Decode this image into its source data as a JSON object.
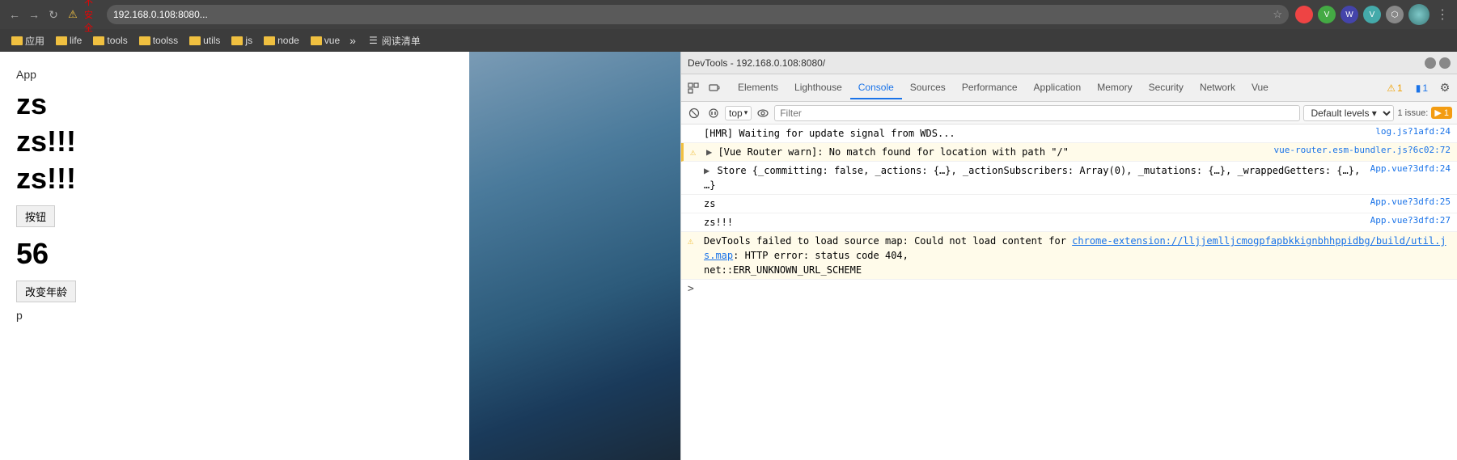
{
  "browser": {
    "url": "192.168.0.108:8080...",
    "security_warning": "不安全",
    "bookmarks": [
      {
        "label": "应用",
        "type": "folder"
      },
      {
        "label": "life",
        "type": "folder"
      },
      {
        "label": "tools",
        "type": "folder"
      },
      {
        "label": "toolss",
        "type": "folder"
      },
      {
        "label": "utils",
        "type": "folder"
      },
      {
        "label": "js",
        "type": "folder"
      },
      {
        "label": "node",
        "type": "folder"
      },
      {
        "label": "vue",
        "type": "folder"
      },
      {
        "label": "阅读清单",
        "type": "link"
      }
    ],
    "more_label": "»"
  },
  "webpage": {
    "app_label": "App",
    "zs": "zs",
    "zs_exclaim1": "zs!!!",
    "zs_exclaim2": "zs!!!",
    "button1": "按钮",
    "number": "56",
    "button2": "改变年龄",
    "p_text": "p"
  },
  "devtools": {
    "title": "DevTools - 192.168.0.108:8080/",
    "tabs": [
      {
        "label": "Elements",
        "active": false
      },
      {
        "label": "Lighthouse",
        "active": false
      },
      {
        "label": "Console",
        "active": true
      },
      {
        "label": "Sources",
        "active": false
      },
      {
        "label": "Performance",
        "active": false
      },
      {
        "label": "Application",
        "active": false
      },
      {
        "label": "Memory",
        "active": false
      },
      {
        "label": "Security",
        "active": false
      },
      {
        "label": "Network",
        "active": false
      },
      {
        "label": "Vue",
        "active": false
      }
    ],
    "toolbar": {
      "context": "top",
      "filter_placeholder": "Filter",
      "levels": "Default levels ▾",
      "issue_count": "1 issue:",
      "issue_badge": "▶ 1"
    },
    "console_lines": [
      {
        "type": "info",
        "icon": "",
        "text": "[HMR] Waiting for update signal from WDS...",
        "file": "log.js?1afd:24"
      },
      {
        "type": "warning",
        "icon": "⚠",
        "text": "▶[Vue Router warn]: No match found for location with path \"/\"",
        "file": "vue-router.esm-bundler.js?6c02:72"
      },
      {
        "type": "info",
        "icon": "▶",
        "text": "Store {_committing: false, _actions: {…}, _actionSubscribers: Array(0), _mutations: {…}, _wrappedGetters: {…}, …}",
        "file": "App.vue?3dfd:24"
      },
      {
        "type": "info",
        "icon": "",
        "text": "zs",
        "file": "App.vue?3dfd:25"
      },
      {
        "type": "info",
        "icon": "",
        "text": "zs!!!",
        "file": "App.vue?3dfd:27"
      },
      {
        "type": "warning",
        "icon": "⚠",
        "text": "DevTools failed to load source map: Could not load content for chrome-extension://lljjemlljcmogpfapbkkignbhhppidbg/build/util.js.map: HTTP error: status code 404, net::ERR_UNKNOWN_URL_SCHEME",
        "file": "",
        "has_link": true,
        "link_text": "chrome-extension://lljjemlljcmogpfapbkkignbhhppidbg/build/util.js.map"
      }
    ],
    "prompt": ">"
  }
}
